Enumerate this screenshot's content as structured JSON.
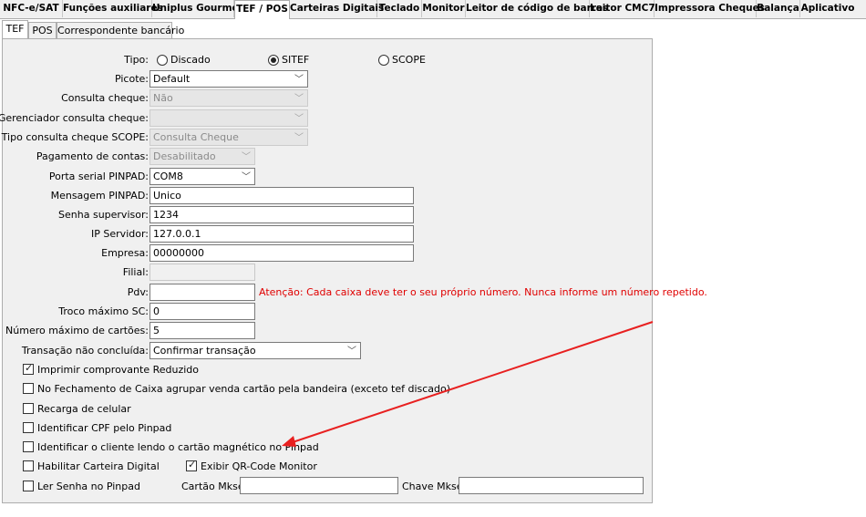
{
  "top_tabs": [
    "NFC-e/SAT",
    "Funções auxiliares",
    "Uniplus Gourmet",
    "TEF / POS",
    "Carteiras Digitais",
    "Teclado",
    "Monitor",
    "Leitor de código de barras",
    "Leitor CMC7",
    "Impressora Cheques",
    "Balança",
    "Aplicativo"
  ],
  "sub_tabs": [
    "TEF",
    "POS",
    "Correspondente bancário"
  ],
  "tipo": {
    "label": "Tipo:",
    "options": [
      "Discado",
      "SITEF",
      "SCOPE"
    ],
    "selected": "SITEF"
  },
  "fields": {
    "picote": {
      "label": "Picote:",
      "value": "Default"
    },
    "consulta_cheque": {
      "label": "Consulta cheque:",
      "value": "Não"
    },
    "gerenciador": {
      "label": "Gerenciador consulta cheque:",
      "value": ""
    },
    "tipo_scope": {
      "label": "Tipo consulta cheque SCOPE:",
      "value": "Consulta Cheque"
    },
    "pagamento": {
      "label": "Pagamento de contas:",
      "value": "Desabilitado"
    },
    "porta": {
      "label": "Porta serial PINPAD:",
      "value": "COM8"
    },
    "mensagem": {
      "label": "Mensagem PINPAD:",
      "value": "Unico"
    },
    "senha": {
      "label": "Senha supervisor:",
      "value": "1234"
    },
    "ip": {
      "label": "IP Servidor:",
      "value": "127.0.0.1"
    },
    "empresa": {
      "label": "Empresa:",
      "value": "00000000"
    },
    "filial": {
      "label": "Filial:",
      "value": ""
    },
    "pdv": {
      "label": "Pdv:",
      "value": ""
    },
    "troco": {
      "label": "Troco máximo SC:",
      "value": "0"
    },
    "num_cartoes": {
      "label": "Número máximo de cartões:",
      "value": "5"
    },
    "transacao": {
      "label": "Transação não concluída:",
      "value": "Confirmar transação"
    }
  },
  "pdv_warning": "Atenção: Cada caixa deve ter o seu próprio número. Nunca informe um número repetido.",
  "checkboxes": {
    "imprimir": {
      "label": "Imprimir comprovante Reduzido",
      "checked": true
    },
    "fechamento": {
      "label": "No Fechamento de Caixa agrupar venda cartão pela bandeira (exceto tef discado)",
      "checked": false
    },
    "recarga": {
      "label": "Recarga de celular",
      "checked": false
    },
    "cpf": {
      "label": "Identificar CPF pelo Pinpad",
      "checked": false
    },
    "cartao_mag": {
      "label": "Identificar o cliente lendo o cartão magnético no Pinpad",
      "checked": false
    },
    "carteira": {
      "label": "Habilitar Carteira Digital",
      "checked": false
    },
    "qrcode": {
      "label": "Exibir QR-Code Monitor",
      "checked": true
    },
    "ler_senha": {
      "label": "Ler Senha no Pinpad",
      "checked": false
    }
  },
  "mkse": {
    "cartao_label": "Cartão Mkse:",
    "cartao_value": "",
    "chave_label": "Chave Mkse:",
    "chave_value": ""
  },
  "colors": {
    "warning": "#e00000",
    "arrow": "#e82020"
  }
}
